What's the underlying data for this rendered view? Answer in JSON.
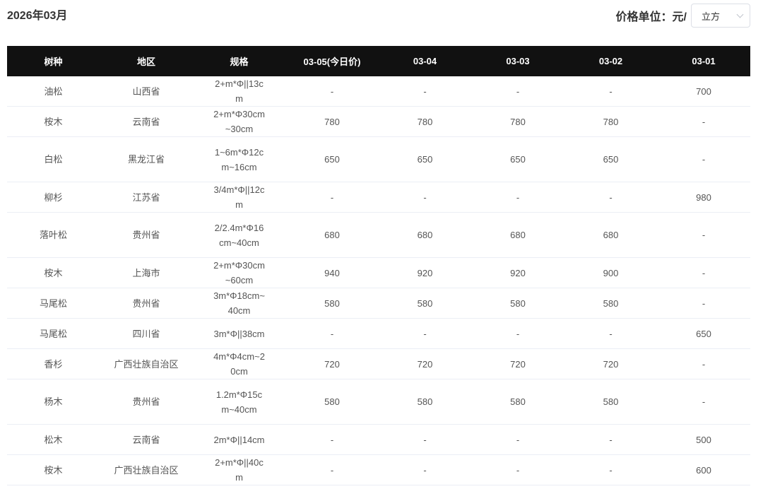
{
  "header": {
    "month": "2026年03月",
    "unit_label": "价格单位：元/",
    "unit_selected": "立方"
  },
  "table": {
    "columns": [
      "树种",
      "地区",
      "规格",
      "03-05(今日价)",
      "03-04",
      "03-03",
      "03-02",
      "03-01"
    ],
    "rows": [
      {
        "species": "油松",
        "region": "山西省",
        "spec": "2+m*Φ||13cm",
        "p1": "-",
        "p2": "-",
        "p3": "-",
        "p4": "-",
        "p5": "700"
      },
      {
        "species": "桉木",
        "region": "云南省",
        "spec": "2+m*Φ30cm~30cm",
        "p1": "780",
        "p2": "780",
        "p3": "780",
        "p4": "780",
        "p5": "-"
      },
      {
        "species": "白松",
        "region": "黑龙江省",
        "spec": "1~6m*Φ12cm~16cm",
        "p1": "650",
        "p2": "650",
        "p3": "650",
        "p4": "650",
        "p5": "-"
      },
      {
        "species": "柳杉",
        "region": "江苏省",
        "spec": "3/4m*Φ||12cm",
        "p1": "-",
        "p2": "-",
        "p3": "-",
        "p4": "-",
        "p5": "980"
      },
      {
        "species": "落叶松",
        "region": "贵州省",
        "spec": "2/2.4m*Φ16cm~40cm",
        "p1": "680",
        "p2": "680",
        "p3": "680",
        "p4": "680",
        "p5": "-"
      },
      {
        "species": "桉木",
        "region": "上海市",
        "spec": "2+m*Φ30cm~60cm",
        "p1": "940",
        "p2": "920",
        "p3": "920",
        "p4": "900",
        "p5": "-"
      },
      {
        "species": "马尾松",
        "region": "贵州省",
        "spec": "3m*Φ18cm~40cm",
        "p1": "580",
        "p2": "580",
        "p3": "580",
        "p4": "580",
        "p5": "-"
      },
      {
        "species": "马尾松",
        "region": "四川省",
        "spec": "3m*Φ||38cm",
        "p1": "-",
        "p2": "-",
        "p3": "-",
        "p4": "-",
        "p5": "650"
      },
      {
        "species": "香杉",
        "region": "广西壮族自治区",
        "spec": "4m*Φ4cm~20cm",
        "p1": "720",
        "p2": "720",
        "p3": "720",
        "p4": "720",
        "p5": "-"
      },
      {
        "species": "杨木",
        "region": "贵州省",
        "spec": "1.2m*Φ15cm~40cm",
        "p1": "580",
        "p2": "580",
        "p3": "580",
        "p4": "580",
        "p5": "-"
      },
      {
        "species": "松木",
        "region": "云南省",
        "spec": "2m*Φ||14cm",
        "p1": "-",
        "p2": "-",
        "p3": "-",
        "p4": "-",
        "p5": "500"
      },
      {
        "species": "桉木",
        "region": "广西壮族自治区",
        "spec": "2+m*Φ||40cm",
        "p1": "-",
        "p2": "-",
        "p3": "-",
        "p4": "-",
        "p5": "600"
      }
    ]
  }
}
